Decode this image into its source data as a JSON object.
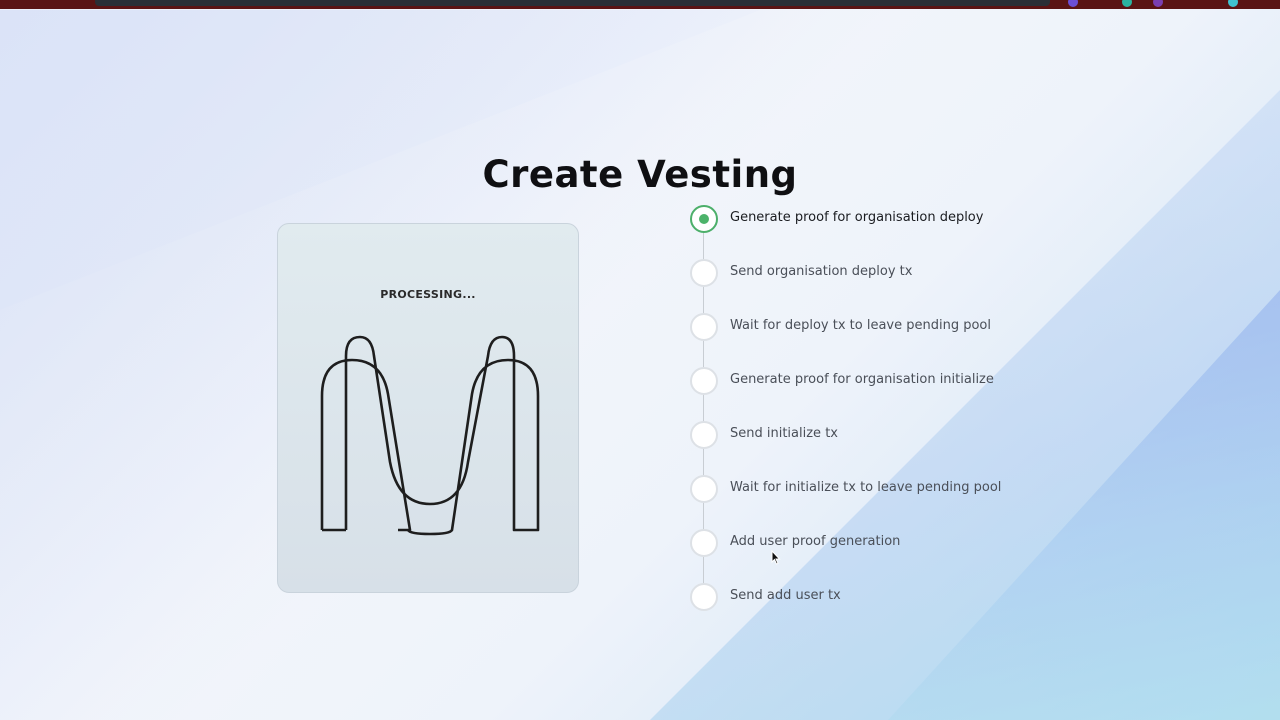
{
  "page": {
    "title": "Create Vesting"
  },
  "card": {
    "status": "PROCESSING..."
  },
  "colors": {
    "accent_active": "#4cb36a",
    "title": "#0f0f12",
    "card_bg": "#dfe8ee"
  },
  "steps": [
    {
      "label": "Generate proof for organisation deploy",
      "state": "active"
    },
    {
      "label": "Send organisation deploy tx",
      "state": "pending"
    },
    {
      "label": "Wait for deploy tx to leave pending pool",
      "state": "pending"
    },
    {
      "label": "Generate proof for organisation initialize",
      "state": "pending"
    },
    {
      "label": "Send initialize tx",
      "state": "pending"
    },
    {
      "label": "Wait for initialize tx to leave pending pool",
      "state": "pending"
    },
    {
      "label": "Add user proof generation",
      "state": "pending"
    },
    {
      "label": "Send add user tx",
      "state": "pending"
    }
  ]
}
